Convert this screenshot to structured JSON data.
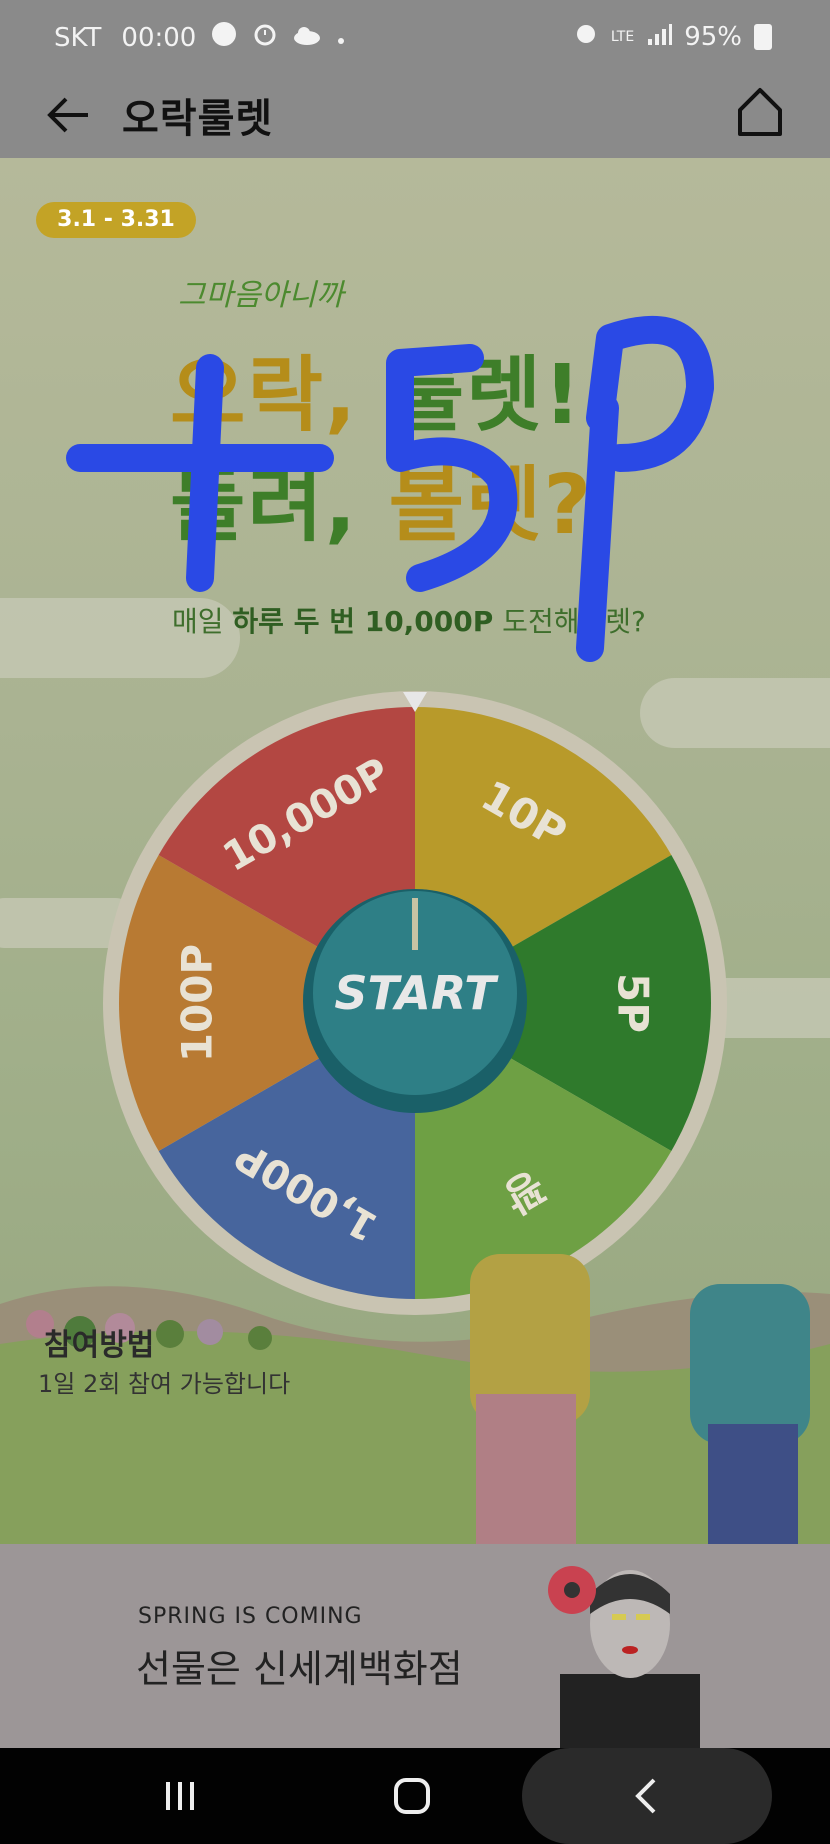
{
  "status_bar": {
    "carrier": "SKT",
    "time": "00:00",
    "network": "LTE",
    "battery": "95%"
  },
  "header": {
    "title": "오락룰렛",
    "icons": [
      "back-arrow-icon",
      "home-icon"
    ]
  },
  "banner": {
    "date_range": "3.1 - 3.31",
    "tagline": "그마음아니까",
    "headline_line1_a": "오락,",
    "headline_line1_b": "룰렛!",
    "headline_line2_a": "돌려,",
    "headline_line2_b": "볼렛?",
    "subline_pre": "매일 ",
    "subline_bold": "하루 두 번 10,000P",
    "subline_post": " 도전해볼렛?",
    "handwriting": "+5P"
  },
  "roulette": {
    "start_label": "START",
    "segments": [
      {
        "label": "10P",
        "color": "#b89a2a"
      },
      {
        "label": "5P",
        "color": "#2f7a2c"
      },
      {
        "label": "꽝",
        "color": "#6ea044"
      },
      {
        "label": "1,000P",
        "color": "#47659d"
      },
      {
        "label": "100P",
        "color": "#b87a33"
      },
      {
        "label": "10,000P",
        "color": "#b34742"
      }
    ]
  },
  "guide": {
    "title": "참여방법",
    "line1": "1일 2회 참여 가능합니다"
  },
  "ad": {
    "small": "SPRING  IS COMING",
    "big": "선물은 신세계백화점"
  },
  "nav_bar": {
    "icons": [
      "recent-apps-icon",
      "home-circle-icon",
      "back-chevron-icon"
    ]
  }
}
